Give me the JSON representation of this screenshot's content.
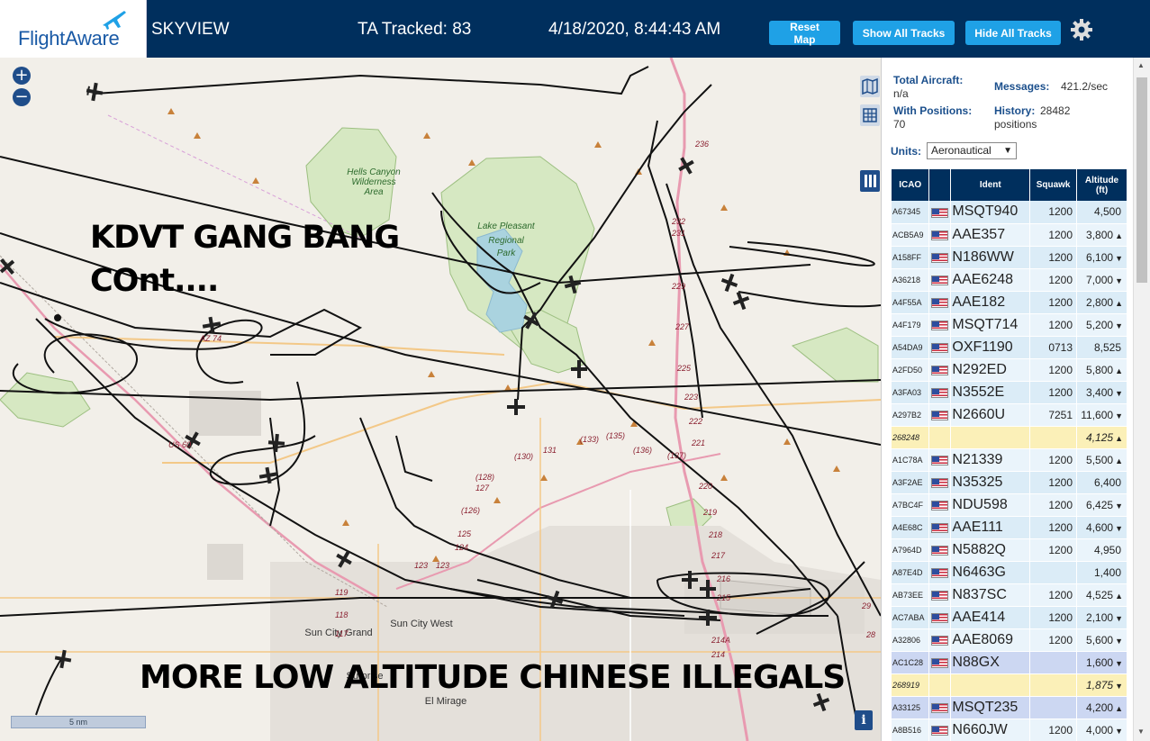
{
  "header": {
    "logo_text": "FlightAware",
    "app_name": "SKYVIEW",
    "tracked": "TA Tracked: 83",
    "datetime": "4/18/2020, 8:44:43 AM",
    "buttons": {
      "reset": "Reset Map",
      "show": "Show All Tracks",
      "hide": "Hide All Tracks"
    },
    "bg_color": "#002f5d",
    "button_color": "#1fa1e6"
  },
  "map": {
    "zoom_in": "+",
    "zoom_out": "−",
    "overlay_top_line1": "KDVT GANG BANG",
    "overlay_top_line2": "COnt....",
    "overlay_bottom": "MORE LOW ALTITUDE CHINESE ILLEGALS",
    "scale_label": "5 nm",
    "info_label": "i",
    "place_labels": {
      "hells_canyon_1": "Hells Canyon",
      "hells_canyon_2": "Wilderness",
      "hells_canyon_3": "Area",
      "lake_1": "Lake Pleasant",
      "lake_2": "Regional",
      "lake_3": "Park",
      "sun_city_west": "Sun City West",
      "sun_city_grand": "Sun City Grand",
      "surprise": "Surprise",
      "el_mirage": "El Mirage"
    },
    "road_labels": {
      "a74": "AZ 74",
      "us60": "US 60",
      "r236": "236",
      "r232": "232",
      "r231": "231",
      "r229": "229",
      "r227": "227",
      "r225": "225",
      "r223": "223",
      "r222": "222",
      "r221": "221",
      "r220": "220",
      "r219": "219",
      "r218": "218",
      "r217": "217",
      "r216": "216",
      "r215": "215",
      "r214a": "214A",
      "r214": "214",
      "r131": "131",
      "r130": "(130)",
      "r133": "(133)",
      "r135": "(135)",
      "r136": "(136)",
      "r137": "(137)",
      "r128": "(128)",
      "r127": "127",
      "r126": "(126)",
      "r125": "125",
      "r124": "124",
      "r123a": "123",
      "r123b": "123",
      "r119": "119",
      "r118": "118",
      "r117": "117",
      "r29": "29",
      "r28": "28"
    }
  },
  "stats": {
    "total_aircraft_label": "Total Aircraft:",
    "total_aircraft_value": "n/a",
    "with_positions_label": "With Positions:",
    "with_positions_value": "70",
    "messages_label": "Messages:",
    "messages_value": "421.2/sec",
    "history_label": "History:",
    "history_value": "28482",
    "history_unit": "positions",
    "units_label": "Units:",
    "units_value": "Aeronautical"
  },
  "table": {
    "headers": {
      "icao": "ICAO",
      "ident": "Ident",
      "squawk": "Squawk",
      "altitude": "Altitude",
      "altitude_unit": "(ft)"
    },
    "rows": [
      {
        "icao": "A67345",
        "ident": "MSQT940",
        "squawk": "1200",
        "alt": "4,500",
        "trend": ""
      },
      {
        "icao": "ACB5A9",
        "ident": "AAE357",
        "squawk": "1200",
        "alt": "3,800",
        "trend": "▲"
      },
      {
        "icao": "A158FF",
        "ident": "N186WW",
        "squawk": "1200",
        "alt": "6,100",
        "trend": "▼"
      },
      {
        "icao": "A36218",
        "ident": "AAE6248",
        "squawk": "1200",
        "alt": "7,000",
        "trend": "▼"
      },
      {
        "icao": "A4F55A",
        "ident": "AAE182",
        "squawk": "1200",
        "alt": "2,800",
        "trend": "▲"
      },
      {
        "icao": "A4F179",
        "ident": "MSQT714",
        "squawk": "1200",
        "alt": "5,200",
        "trend": "▼"
      },
      {
        "icao": "A54DA9",
        "ident": "OXF1190",
        "squawk": "0713",
        "alt": "8,525",
        "trend": ""
      },
      {
        "icao": "A2FD50",
        "ident": "N292ED",
        "squawk": "1200",
        "alt": "5,800",
        "trend": "▲"
      },
      {
        "icao": "A3FA03",
        "ident": "N3552E",
        "squawk": "1200",
        "alt": "3,400",
        "trend": "▼"
      },
      {
        "icao": "A297B2",
        "ident": "N2660U",
        "squawk": "7251",
        "alt": "11,600",
        "trend": "▼"
      },
      {
        "icao": "268248",
        "ident": "",
        "squawk": "",
        "alt": "4,125",
        "trend": "▲",
        "style": "yellow"
      },
      {
        "icao": "A1C78A",
        "ident": "N21339",
        "squawk": "1200",
        "alt": "5,500",
        "trend": "▲"
      },
      {
        "icao": "A3F2AE",
        "ident": "N35325",
        "squawk": "1200",
        "alt": "6,400",
        "trend": ""
      },
      {
        "icao": "A7BC4F",
        "ident": "NDU598",
        "squawk": "1200",
        "alt": "6,425",
        "trend": "▼"
      },
      {
        "icao": "A4E68C",
        "ident": "AAE111",
        "squawk": "1200",
        "alt": "4,600",
        "trend": "▼"
      },
      {
        "icao": "A7964D",
        "ident": "N5882Q",
        "squawk": "1200",
        "alt": "4,950",
        "trend": ""
      },
      {
        "icao": "A87E4D",
        "ident": "N6463G",
        "squawk": "",
        "alt": "1,400",
        "trend": ""
      },
      {
        "icao": "AB73EE",
        "ident": "N837SC",
        "squawk": "1200",
        "alt": "4,525",
        "trend": "▲"
      },
      {
        "icao": "AC7ABA",
        "ident": "AAE414",
        "squawk": "1200",
        "alt": "2,100",
        "trend": "▼"
      },
      {
        "icao": "A32806",
        "ident": "AAE8069",
        "squawk": "1200",
        "alt": "5,600",
        "trend": "▼"
      },
      {
        "icao": "AC1C28",
        "ident": "N88GX",
        "squawk": "",
        "alt": "1,600",
        "trend": "▼",
        "style": "hl"
      },
      {
        "icao": "268919",
        "ident": "",
        "squawk": "",
        "alt": "1,875",
        "trend": "▼",
        "style": "yellow"
      },
      {
        "icao": "A33125",
        "ident": "MSQT235",
        "squawk": "",
        "alt": "4,200",
        "trend": "▲",
        "style": "hl"
      },
      {
        "icao": "A8B516",
        "ident": "N660JW",
        "squawk": "1200",
        "alt": "4,000",
        "trend": "▼"
      }
    ]
  }
}
